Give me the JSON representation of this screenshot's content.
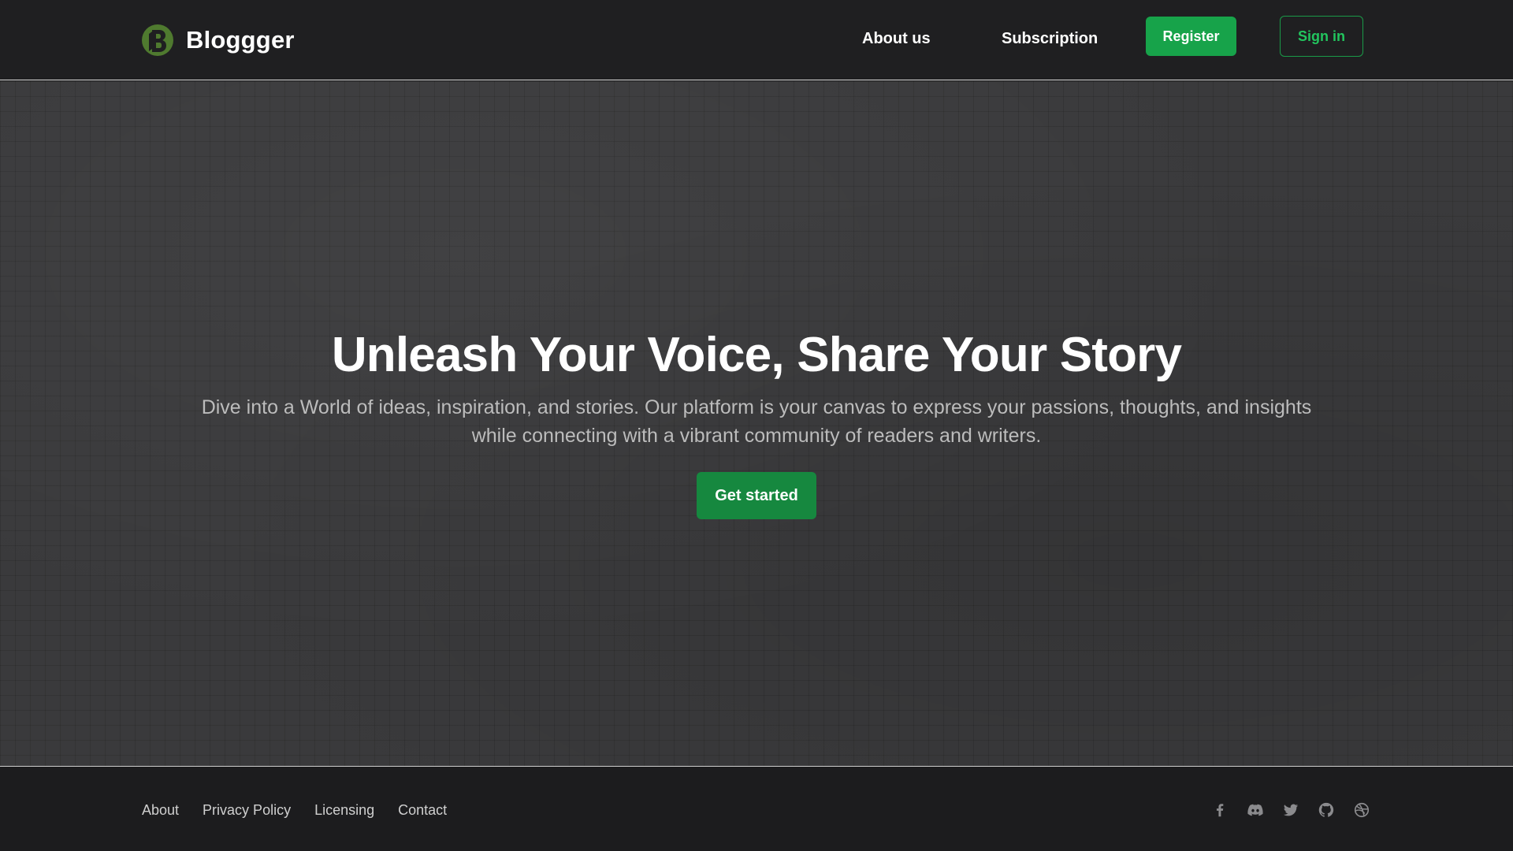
{
  "header": {
    "brand": "Bloggger",
    "nav": {
      "about_label": "About us",
      "subscription_label": "Subscription"
    },
    "register_label": "Register",
    "signin_label": "Sign in"
  },
  "hero": {
    "title": "Unleash Your Voice, Share Your Story",
    "subtitle": "Dive into a World of ideas, inspiration, and stories. Our platform is your canvas to express your passions, thoughts, and insights while connecting with a vibrant community of readers and writers.",
    "cta_label": "Get started"
  },
  "footer": {
    "links": [
      "About",
      "Privacy Policy",
      "Licensing",
      "Contact"
    ],
    "social_icons": [
      "facebook-icon",
      "discord-icon",
      "twitter-icon",
      "github-icon",
      "dribbble-icon"
    ]
  },
  "colors": {
    "accent": "#17a34a",
    "navbar_bg": "#1f1f21",
    "hero_bg": "#3a3a3c",
    "footer_bg": "#1c1c1e"
  }
}
